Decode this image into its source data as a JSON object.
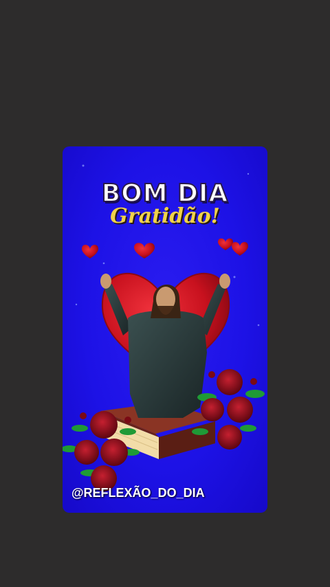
{
  "post": {
    "title": "BOM DIA",
    "subtitle": "Gratidão!",
    "handle": "@REFLEXÃO_DO_DIA"
  },
  "colors": {
    "page_background": "#2d2c2c",
    "card_background": "#1d12e6",
    "title_text": "#ffffff",
    "subtitle_text": "#f0d24a",
    "heart": "#c8111e",
    "rose": "#8e0f1a",
    "leaf": "#1f9a36",
    "robe": "#28393a",
    "book": "#7a2c1e"
  }
}
